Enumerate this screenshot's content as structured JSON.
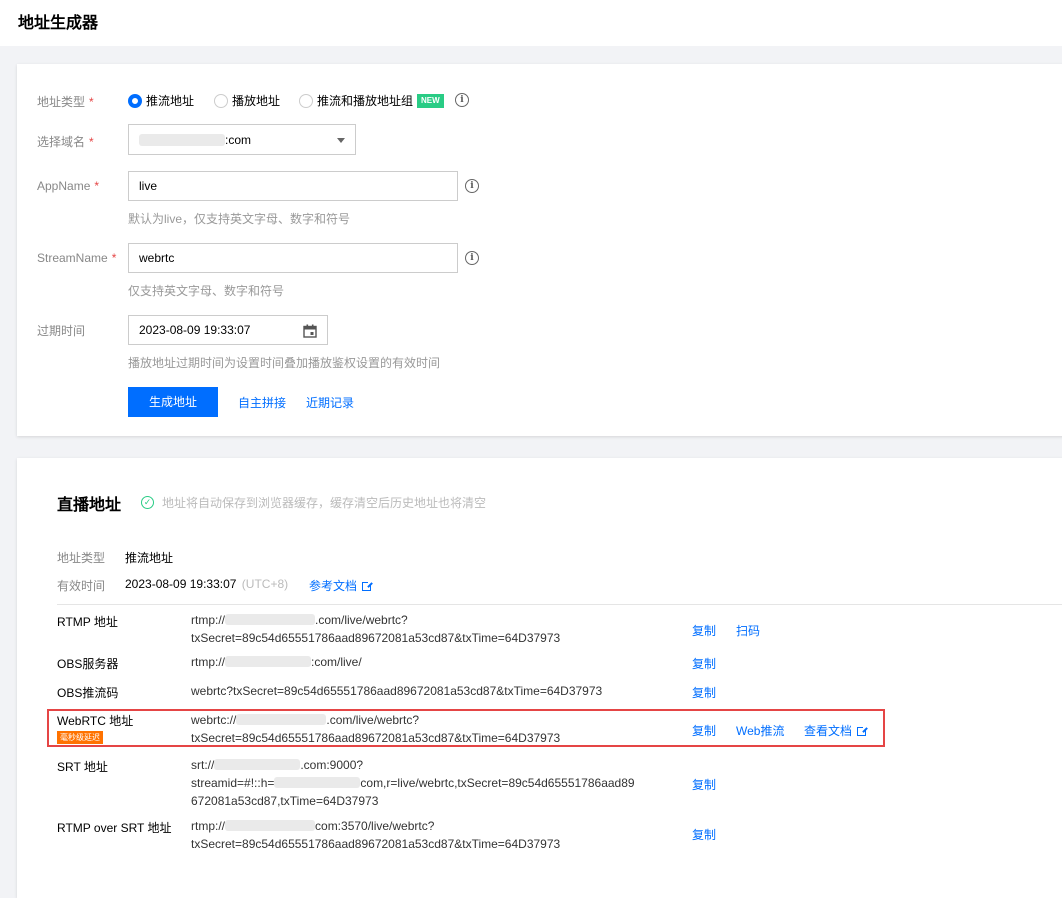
{
  "page_title": "地址生成器",
  "form": {
    "address_type": {
      "label": "地址类型",
      "options": [
        "推流地址",
        "播放地址",
        "推流和播放地址组"
      ],
      "selected": "推流地址",
      "new_badge": "NEW"
    },
    "domain": {
      "label": "选择域名",
      "value_suffix": ":com"
    },
    "appname": {
      "label": "AppName",
      "value": "live",
      "hint": "默认为live，仅支持英文字母、数字和符号"
    },
    "streamname": {
      "label": "StreamName",
      "value": "webrtc",
      "hint": "仅支持英文字母、数字和符号"
    },
    "expire": {
      "label": "过期时间",
      "value": "2023-08-09 19:33:07",
      "hint": "播放地址过期时间为设置时间叠加播放鉴权设置的有效时间"
    },
    "required_mark": "*",
    "generate_button": "生成地址",
    "custom_link": "自主拼接",
    "history_link": "近期记录"
  },
  "live": {
    "title": "直播地址",
    "save_note": "地址将自动保存到浏览器缓存，缓存清空后历史地址也将清空",
    "type_label": "地址类型",
    "type_value": "推流地址",
    "valid_label": "有效时间",
    "valid_value": "2023-08-09 19:33:07",
    "valid_tz": "(UTC+8)",
    "doc_link": "参考文档",
    "rows": [
      {
        "label": "RTMP 地址",
        "line1_prefix": "rtmp://",
        "line1_suffix": ".com/live/webrtc?",
        "line2": "txSecret=89c54d65551786aad89672081a53cd87&txTime=64D37973",
        "actions": [
          "复制",
          "扫码"
        ]
      },
      {
        "label": "OBS服务器",
        "line1_prefix": "rtmp://",
        "line1_suffix": ":com/live/",
        "actions": [
          "复制"
        ]
      },
      {
        "label": "OBS推流码",
        "line1": "webrtc?txSecret=89c54d65551786aad89672081a53cd87&txTime=64D37973",
        "actions": [
          "复制"
        ]
      },
      {
        "label": "WebRTC 地址",
        "badge": "毫秒级延迟",
        "line1_prefix": "webrtc://",
        "line1_suffix": ".com/live/webrtc?",
        "line2": "txSecret=89c54d65551786aad89672081a53cd87&txTime=64D37973",
        "actions": [
          "复制",
          "Web推流",
          "查看文档"
        ]
      },
      {
        "label": "SRT 地址",
        "line1_prefix": "srt://",
        "line1_suffix": ".com:9000?",
        "line2_prefix": "streamid=#!::h=",
        "line2_suffix": "com,r=live/webrtc,txSecret=89c54d65551786aad89",
        "line3": "672081a53cd87,txTime=64D37973",
        "actions": [
          "复制"
        ]
      },
      {
        "label": "RTMP over SRT 地址",
        "line1_prefix": "rtmp://",
        "line1_suffix": "com:3570/live/webrtc?",
        "line2": "txSecret=89c54d65551786aad89672081a53cd87&txTime=64D37973",
        "actions": [
          "复制"
        ]
      }
    ]
  },
  "colors": {
    "primary": "#006eff",
    "required": "#e54545",
    "success": "#29cc85",
    "badge": "#ff7200"
  }
}
